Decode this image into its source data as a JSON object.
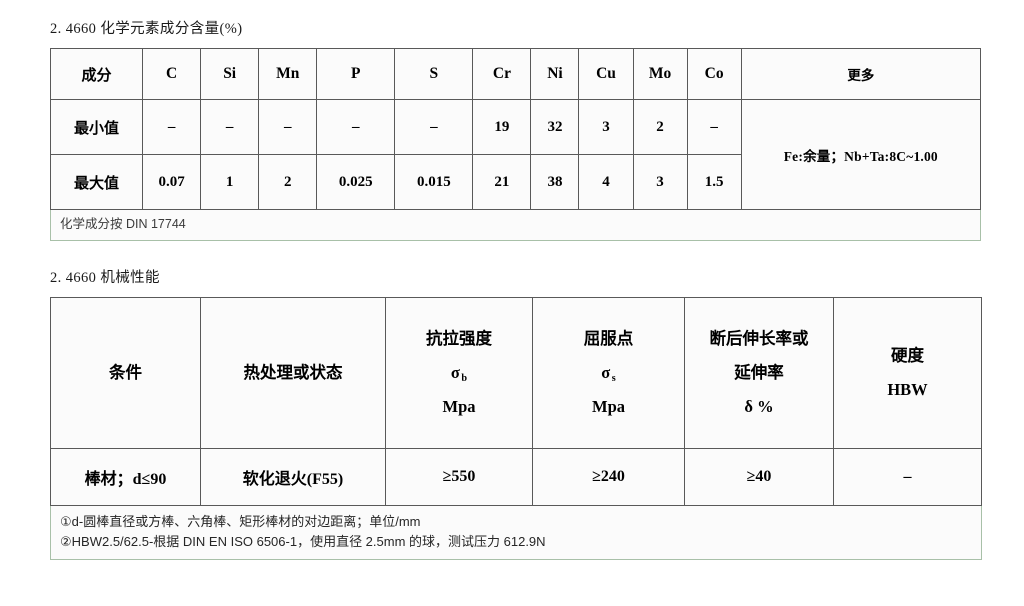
{
  "document": {
    "section1": {
      "title": "2. 4660 化学元素成分含量(%)",
      "table": {
        "headers": [
          "成分",
          "C",
          "Si",
          "Mn",
          "P",
          "S",
          "Cr",
          "Ni",
          "Cu",
          "Mo",
          "Co",
          "更多"
        ],
        "rows": [
          {
            "label": "最小值",
            "values": [
              "–",
              "–",
              "–",
              "–",
              "–",
              "19",
              "32",
              "3",
              "2",
              "–"
            ]
          },
          {
            "label": "最大值",
            "values": [
              "0.07",
              "1",
              "2",
              "0.025",
              "0.015",
              "21",
              "38",
              "4",
              "3",
              "1.5"
            ]
          }
        ],
        "merged_more_cell": "Fe:余量；Nb+Ta:8C~1.00",
        "footnote": "化学成分按 DIN 17744"
      }
    },
    "section2": {
      "title": "2. 4660 机械性能",
      "table": {
        "headers": [
          {
            "lines": [
              "条件"
            ]
          },
          {
            "lines": [
              "热处理或状态"
            ]
          },
          {
            "lines": [
              "抗拉强度",
              "σ_b",
              "Mpa"
            ]
          },
          {
            "lines": [
              "屈服点",
              "σ_s",
              "Mpa"
            ]
          },
          {
            "lines": [
              "断后伸长率或",
              "延伸率",
              "δ %"
            ]
          },
          {
            "lines": [
              "硬度",
              "HBW"
            ]
          }
        ],
        "header_labels": {
          "condition": "条件",
          "heat_treatment": "热处理或状态",
          "tensile_strength": "抗拉强度",
          "tensile_symbol_base": "σ",
          "tensile_symbol_sub": "b",
          "tensile_unit": "Mpa",
          "yield_point": "屈服点",
          "yield_symbol_base": "σ",
          "yield_symbol_sub": "s",
          "yield_unit": "Mpa",
          "elongation_line1": "断后伸长率或",
          "elongation_line2": "延伸率",
          "elongation_symbol": "δ %",
          "hardness_line1": "硬度",
          "hardness_line2": "HBW"
        },
        "rows": [
          {
            "condition": "棒材；d≤90",
            "heat_treatment": "软化退火(F55)",
            "tensile_strength": "≥550",
            "yield_point": "≥240",
            "elongation": "≥40",
            "hardness": "–"
          }
        ],
        "footnotes": [
          "①d-圆棒直径或方棒、六角棒、矩形棒材的对边距离；单位/mm",
          "②HBW2.5/62.5-根据 DIN EN ISO 6506-1，使用直径 2.5mm 的球，测试压力 612.9N"
        ]
      }
    }
  },
  "colors": {
    "outer_border": "#a8c0a8",
    "inner_border": "#595959",
    "cell_background": "#fbfbfb",
    "text": "#000000",
    "footnote_text": "#3a3a3a"
  }
}
